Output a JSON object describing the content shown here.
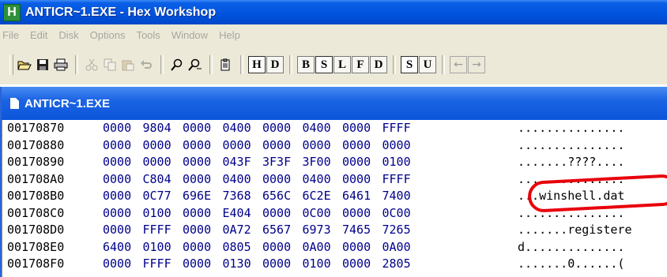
{
  "window": {
    "title": "ANTICR~1.EXE - Hex Workshop",
    "app_icon_letter": "H"
  },
  "menu": [
    "File",
    "Edit",
    "Disk",
    "Options",
    "Tools",
    "Window",
    "Help"
  ],
  "toolbar": {
    "buttons": [
      {
        "icon": "open-folder-icon"
      },
      {
        "icon": "save-disk-icon"
      },
      {
        "icon": "print-icon"
      },
      {
        "icon": "cut-icon",
        "disabled": true
      },
      {
        "icon": "copy-icon",
        "disabled": true
      },
      {
        "icon": "paste-icon",
        "disabled": true
      },
      {
        "icon": "undo-icon",
        "disabled": true
      },
      {
        "icon": "find-icon"
      },
      {
        "icon": "find-next-icon"
      },
      {
        "icon": "clipboard-icon"
      }
    ],
    "view_buttons": [
      "H",
      "D"
    ],
    "size_buttons": [
      "B",
      "S",
      "L",
      "F",
      "D"
    ],
    "sign_buttons": [
      "S",
      "U"
    ],
    "nav": [
      "←",
      "→"
    ]
  },
  "document": {
    "title": "ANTICR~1.EXE",
    "rows": [
      {
        "addr": "00170870",
        "words": [
          "0000",
          "9804",
          "0000",
          "0400",
          "0000",
          "0400",
          "0000",
          "FFFF"
        ],
        "ascii": "..............."
      },
      {
        "addr": "00170880",
        "words": [
          "0000",
          "0000",
          "0000",
          "0000",
          "0000",
          "0000",
          "0000",
          "0000"
        ],
        "ascii": "..............."
      },
      {
        "addr": "00170890",
        "words": [
          "0000",
          "0000",
          "0000",
          "043F",
          "3F3F",
          "3F00",
          "0000",
          "0100"
        ],
        "ascii": ".......????...."
      },
      {
        "addr": "001708A0",
        "words": [
          "0000",
          "C804",
          "0000",
          "0400",
          "0000",
          "0400",
          "0000",
          "FFFF"
        ],
        "ascii": "..............."
      },
      {
        "addr": "001708B0",
        "words": [
          "0000",
          "0C77",
          "696E",
          "7368",
          "656C",
          "6C2E",
          "6461",
          "7400"
        ],
        "ascii": "...winshell.dat"
      },
      {
        "addr": "001708C0",
        "words": [
          "0000",
          "0100",
          "0000",
          "E404",
          "0000",
          "0C00",
          "0000",
          "0C00"
        ],
        "ascii": "..............."
      },
      {
        "addr": "001708D0",
        "words": [
          "0000",
          "FFFF",
          "0000",
          "0A72",
          "6567",
          "6973",
          "7465",
          "7265"
        ],
        "ascii": ".......registere"
      },
      {
        "addr": "001708E0",
        "words": [
          "6400",
          "0100",
          "0000",
          "0805",
          "0000",
          "0A00",
          "0000",
          "0A00"
        ],
        "ascii": "d.............."
      },
      {
        "addr": "001708F0",
        "words": [
          "0000",
          "FFFF",
          "0000",
          "0130",
          "0000",
          "0100",
          "0000",
          "2805"
        ],
        "ascii": ".......0......("
      }
    ]
  },
  "annotation": {
    "color": "#e8000b"
  }
}
